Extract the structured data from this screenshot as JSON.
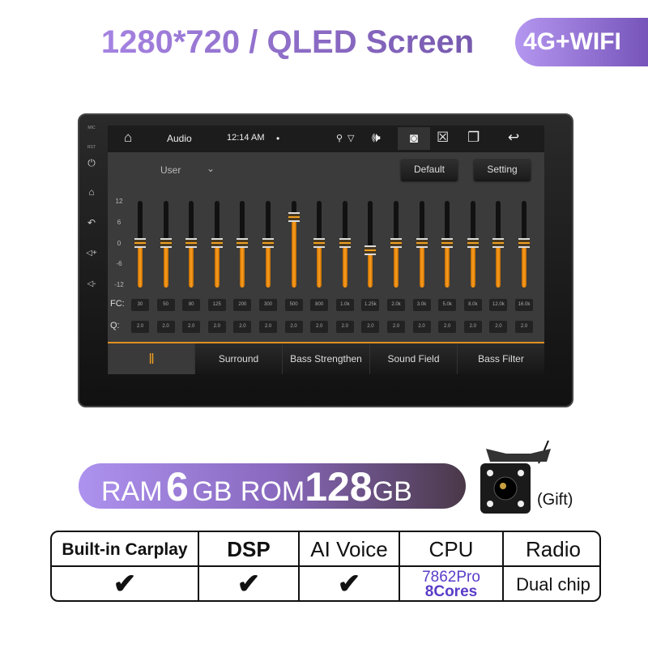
{
  "header": {
    "title": "1280*720 / QLED Screen",
    "badge": "4G+WIFI"
  },
  "device": {
    "side_labels": {
      "mic": "MIC",
      "rst": "RST"
    },
    "side_icons": [
      "power-icon",
      "home-icon",
      "back-icon",
      "volume-up-icon",
      "volume-down-icon"
    ],
    "statusbar": {
      "app": "Audio",
      "time": "12:14 AM",
      "dot": "•"
    },
    "preset": "User",
    "buttons": {
      "default": "Default",
      "setting": "Setting"
    },
    "y_ticks": [
      "12",
      "6",
      "0",
      "-6",
      "-12"
    ],
    "fc_label": "FC:",
    "q_label": "Q:",
    "bands": [
      {
        "fc": "30",
        "q": "2.0",
        "gain": 0
      },
      {
        "fc": "50",
        "q": "2.0",
        "gain": 0
      },
      {
        "fc": "80",
        "q": "2.0",
        "gain": 0
      },
      {
        "fc": "125",
        "q": "2.0",
        "gain": 0
      },
      {
        "fc": "200",
        "q": "2.0",
        "gain": 0
      },
      {
        "fc": "300",
        "q": "2.0",
        "gain": 0
      },
      {
        "fc": "500",
        "q": "2.0",
        "gain": 7.5
      },
      {
        "fc": "800",
        "q": "2.0",
        "gain": 0
      },
      {
        "fc": "1.0k",
        "q": "2.0",
        "gain": 0
      },
      {
        "fc": "1.25k",
        "q": "2.0",
        "gain": -2
      },
      {
        "fc": "2.0k",
        "q": "2.0",
        "gain": 0
      },
      {
        "fc": "3.0k",
        "q": "2.0",
        "gain": 0
      },
      {
        "fc": "5.0k",
        "q": "2.0",
        "gain": 0
      },
      {
        "fc": "8.0k",
        "q": "2.0",
        "gain": 0
      },
      {
        "fc": "12.0k",
        "q": "2.0",
        "gain": 0
      },
      {
        "fc": "16.0k",
        "q": "2.0",
        "gain": 0
      }
    ],
    "tabs": [
      "Surround",
      "Bass Strengthen",
      "Sound Field",
      "Bass Filter"
    ],
    "accent": "#e09020"
  },
  "specs": {
    "ram_label": "RAM",
    "ram_value": "6",
    "ram_unit": "GB",
    "rom_label": "ROM",
    "rom_value": "128",
    "rom_unit": "GB",
    "gift": "(Gift)",
    "table": {
      "headers": [
        "Built-in Carplay",
        "DSP",
        "AI Voice",
        "CPU",
        "Radio"
      ],
      "check": "✔",
      "cpu_model": "7862Pro",
      "cpu_cores": "8Cores",
      "radio": "Dual chip"
    }
  }
}
